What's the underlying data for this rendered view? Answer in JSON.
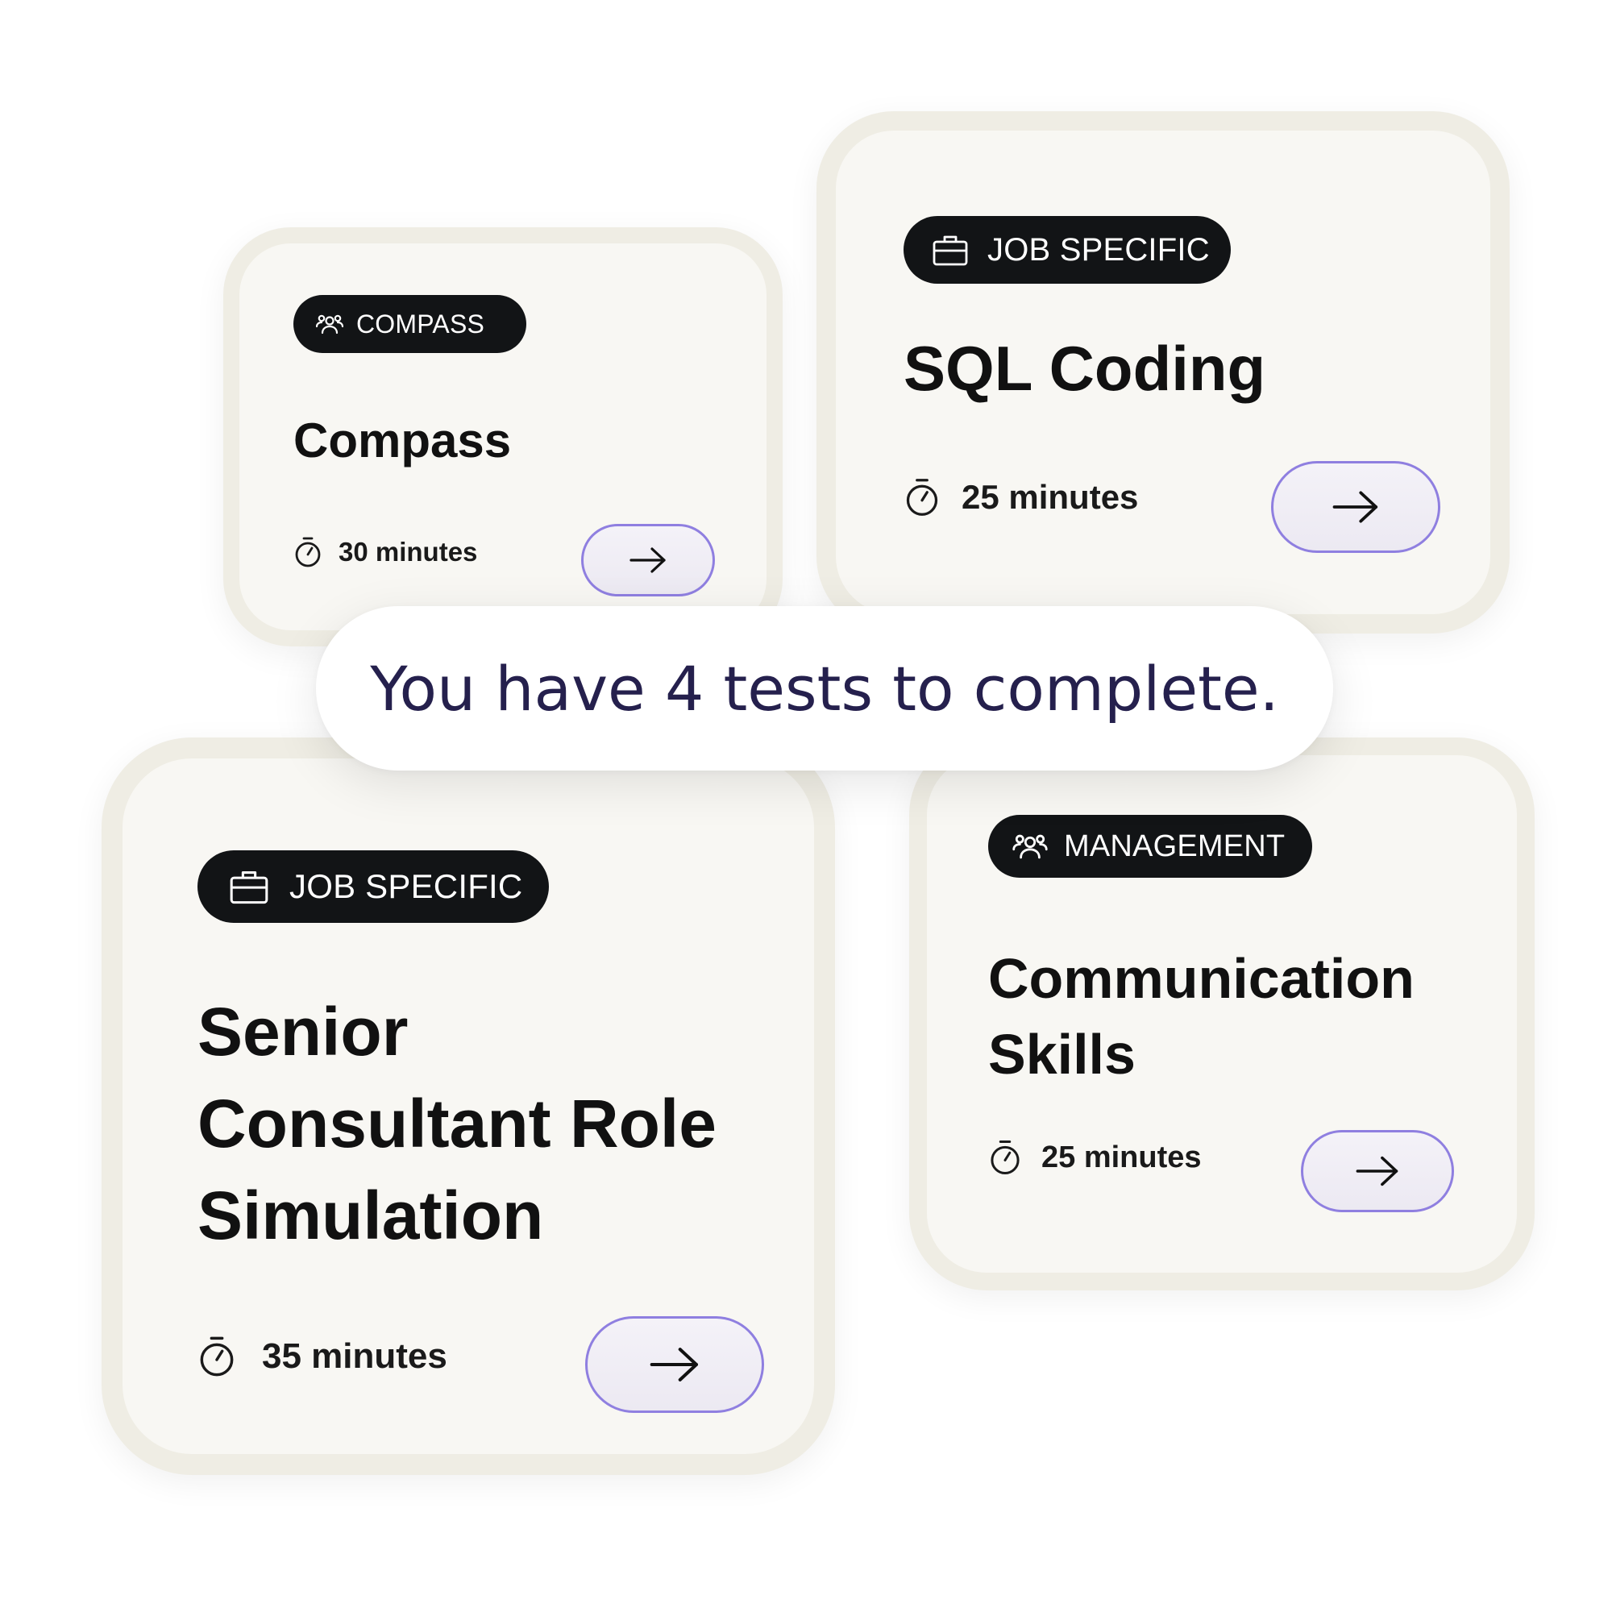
{
  "banner": {
    "text": "You have 4 tests to complete."
  },
  "cards": [
    {
      "id": "compass",
      "badge": {
        "label": "COMPASS",
        "icon": "people-icon"
      },
      "title": "Compass",
      "duration": "30 minutes",
      "action_icon": "arrow-right-icon"
    },
    {
      "id": "sql-coding",
      "badge": {
        "label": "JOB SPECIFIC",
        "icon": "briefcase-icon"
      },
      "title": "SQL Coding",
      "duration": "25 minutes",
      "action_icon": "arrow-right-icon"
    },
    {
      "id": "senior-consultant",
      "badge": {
        "label": "JOB SPECIFIC",
        "icon": "briefcase-icon"
      },
      "title_lines": [
        "Senior",
        "Consultant Role",
        "Simulation"
      ],
      "duration": "35 minutes",
      "action_icon": "arrow-right-icon"
    },
    {
      "id": "communication-skills",
      "badge": {
        "label": "MANAGEMENT",
        "icon": "people-icon"
      },
      "title_lines": [
        "Communication",
        "Skills"
      ],
      "duration": "25 minutes",
      "action_icon": "arrow-right-icon"
    }
  ],
  "colors": {
    "card_background": "#f8f7f3",
    "card_border": "#efede4",
    "badge_background": "#121416",
    "button_border": "#8f7fe0",
    "banner_text": "#25204d"
  }
}
